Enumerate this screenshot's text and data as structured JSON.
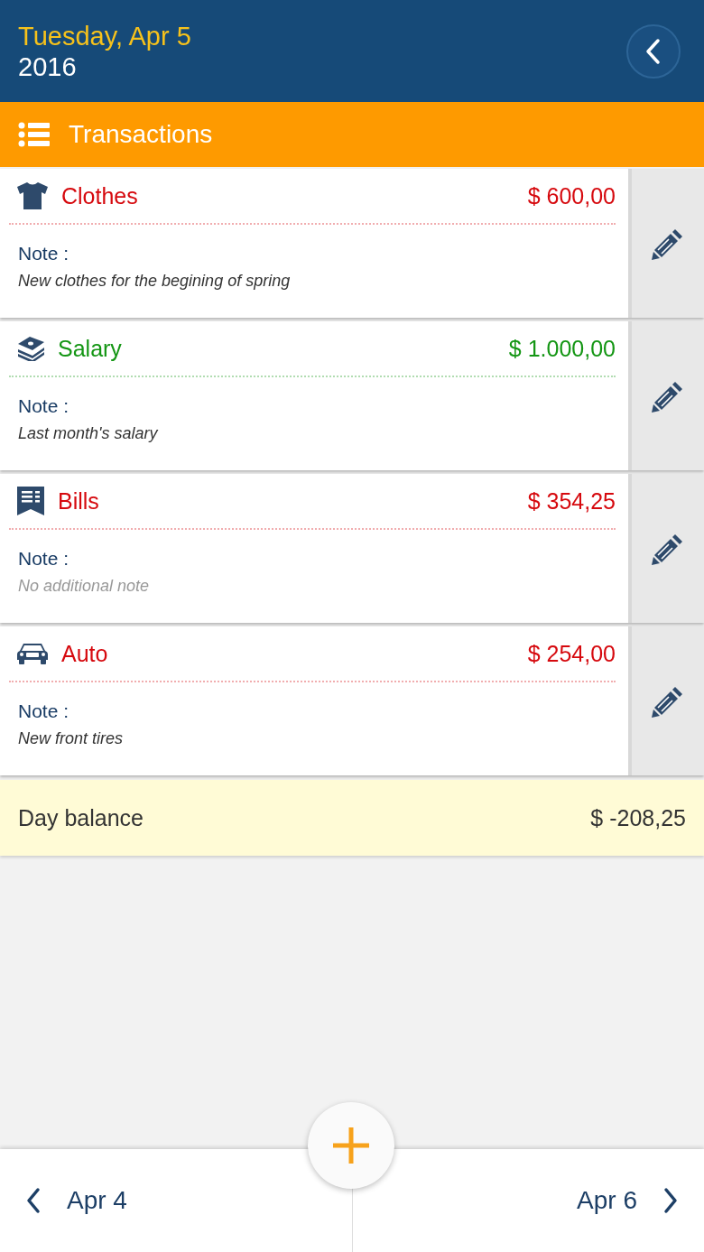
{
  "header": {
    "date": "Tuesday, Apr 5",
    "year": "2016"
  },
  "section": {
    "title": "Transactions"
  },
  "transactions": [
    {
      "kind": "clothes",
      "color": "#d6090e",
      "category": "Clothes",
      "amount": "$ 600,00",
      "note_label": "Note :",
      "note": "New clothes for the begining of spring",
      "note_empty": false
    },
    {
      "kind": "money",
      "color": "#149614",
      "category": "Salary",
      "amount": "$ 1.000,00",
      "note_label": "Note :",
      "note": "Last month's salary",
      "note_empty": false
    },
    {
      "kind": "bill",
      "color": "#d6090e",
      "category": "Bills",
      "amount": "$ 354,25",
      "note_label": "Note :",
      "note": "No additional note",
      "note_empty": true
    },
    {
      "kind": "car",
      "color": "#d6090e",
      "category": "Auto",
      "amount": "$ 254,00",
      "note_label": "Note :",
      "note": "New front tires",
      "note_empty": false
    }
  ],
  "balance": {
    "label": "Day balance",
    "amount": "$ -208,25"
  },
  "footer": {
    "previous": "Apr 4",
    "next": "Apr 6"
  }
}
